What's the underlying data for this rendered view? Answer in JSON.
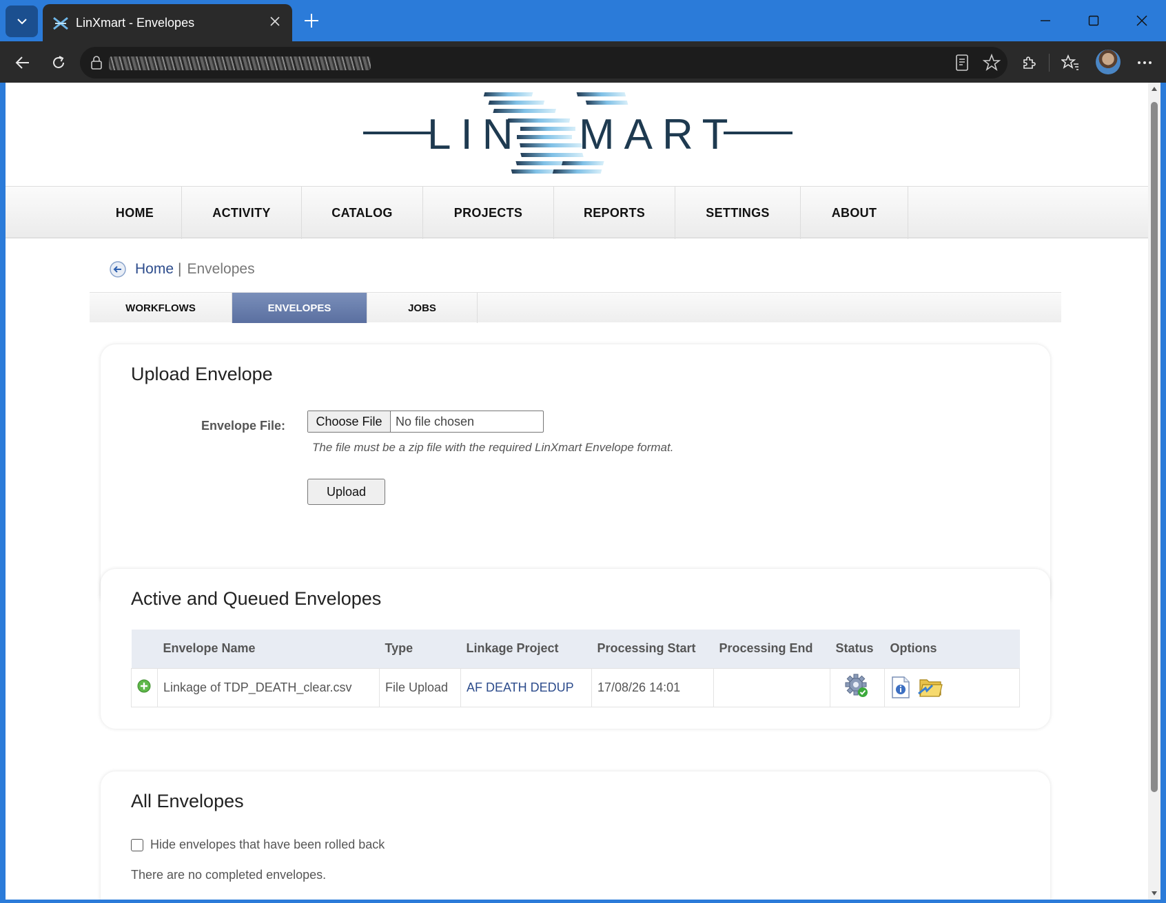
{
  "browser": {
    "tab_title": "LinXmart - Envelopes"
  },
  "logo": {
    "text_left": "LIN",
    "text_right": "MART"
  },
  "mainnav": {
    "items": [
      {
        "label": "HOME"
      },
      {
        "label": "ACTIVITY"
      },
      {
        "label": "CATALOG"
      },
      {
        "label": "PROJECTS"
      },
      {
        "label": "REPORTS"
      },
      {
        "label": "SETTINGS"
      },
      {
        "label": "ABOUT"
      }
    ]
  },
  "breadcrumb": {
    "home": "Home",
    "separator": "|",
    "current": "Envelopes"
  },
  "subtabs": {
    "items": [
      {
        "label": "WORKFLOWS",
        "active": false
      },
      {
        "label": "ENVELOPES",
        "active": true
      },
      {
        "label": "JOBS",
        "active": false
      }
    ]
  },
  "upload": {
    "title": "Upload Envelope",
    "file_label": "Envelope File:",
    "choose_button": "Choose File",
    "no_file": "No file chosen",
    "hint": "The file must be a zip file with the required LinXmart Envelope format.",
    "upload_button": "Upload"
  },
  "active": {
    "title": "Active and Queued Envelopes",
    "columns": [
      "Envelope Name",
      "Type",
      "Linkage Project",
      "Processing Start",
      "Processing End",
      "Status",
      "Options"
    ],
    "rows": [
      {
        "name": "Linkage of TDP_DEATH_clear.csv",
        "type": "File Upload",
        "project": "AF DEATH DEDUP",
        "start": "17/08/26 14:01",
        "end": ""
      }
    ]
  },
  "all": {
    "title": "All Envelopes",
    "hide_label": "Hide envelopes that have been rolled back",
    "empty_text": "There are no completed envelopes."
  },
  "colors": {
    "chrome_blue": "#2b7bd9",
    "dark_toolbar": "#2a2a2a",
    "link_blue": "#2d4c8c",
    "active_tab": "#6a7fb0"
  }
}
